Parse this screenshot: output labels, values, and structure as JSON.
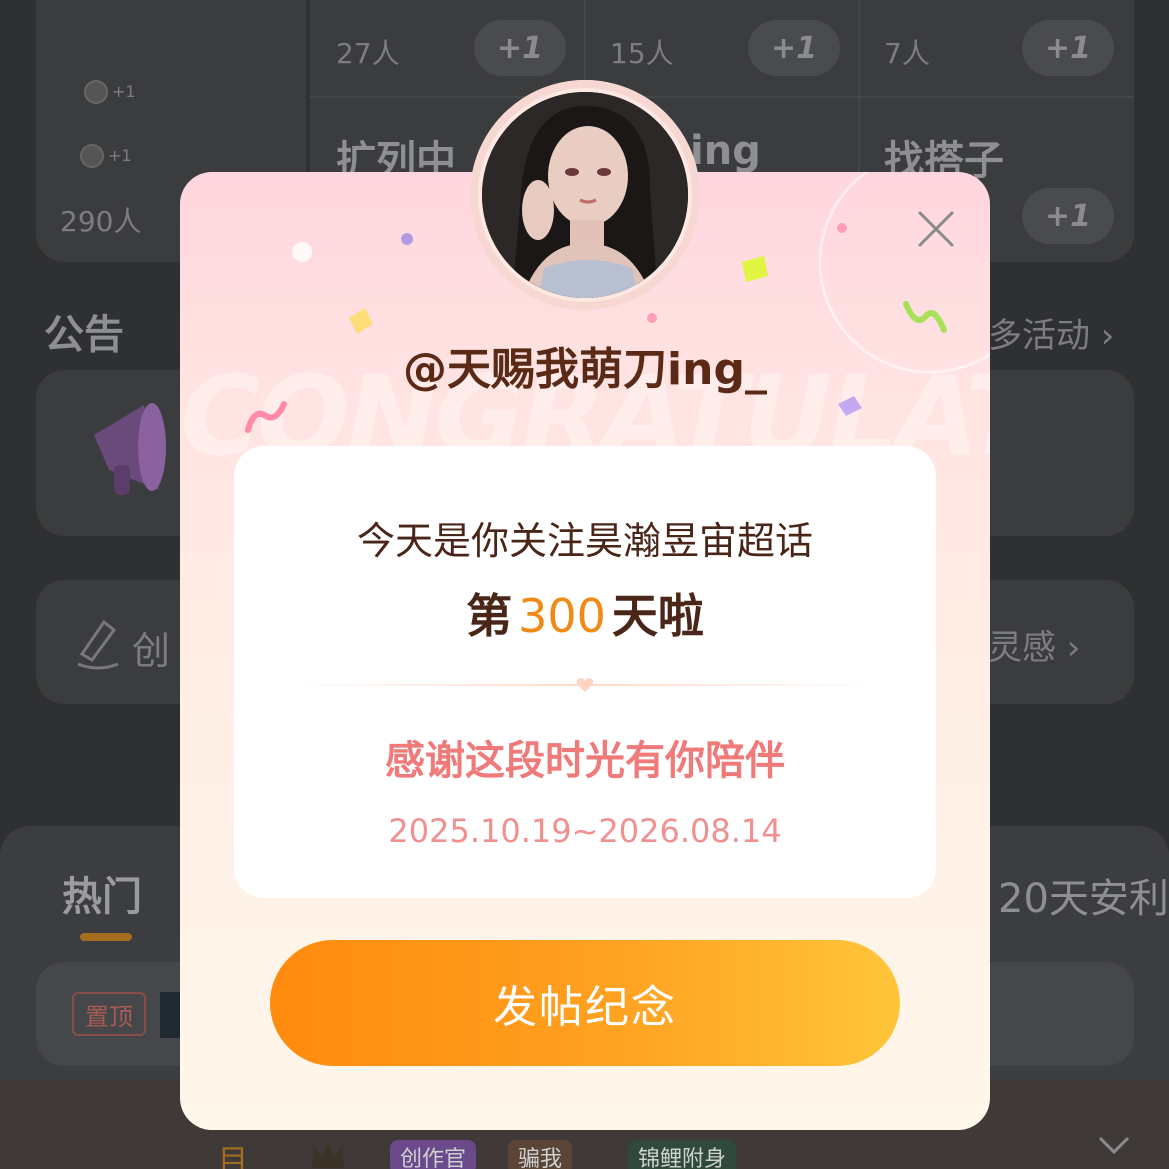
{
  "background": {
    "groups": [
      {
        "name": "扩列中",
        "count": "27人",
        "plus": "+1"
      },
      {
        "name": "ing",
        "count": "15人",
        "plus": "+1"
      },
      {
        "name": "找搭子",
        "count": "7人",
        "plus": "+1"
      }
    ],
    "left_card": {
      "small_plus_1": "+1",
      "small_plus_2": "+1",
      "count": "290人"
    },
    "bottom_plus": "+1",
    "announcement_title": "公告",
    "more_activity": "多活动 ›",
    "create_label": "创",
    "inspiration_label": "灵感 ›",
    "tab_hot": "热门",
    "tab_right": "20天安利",
    "pin_tag": "置顶",
    "bottom_badges": [
      "创作官",
      "骗我",
      "锦鲤附身"
    ],
    "bottom_char": "目"
  },
  "modal": {
    "username": "@天赐我萌刀ing_",
    "bg_word": "CONGRATULATE",
    "message_line1": "今天是你关注昊瀚昱宙超话",
    "message_prefix": "第",
    "days": "300",
    "message_suffix": "天啦",
    "thanks": "感谢这段时光有你陪伴",
    "date_range": "2025.10.19~2026.08.14",
    "cta_label": "发帖纪念",
    "close_icon": "close-icon",
    "colors": {
      "accent_orange": "#f08a16",
      "cta_start": "#ff8a0e",
      "cta_end": "#ffc53a",
      "thanks_pink": "#f07a7a",
      "text_brown": "#4a2618"
    }
  }
}
